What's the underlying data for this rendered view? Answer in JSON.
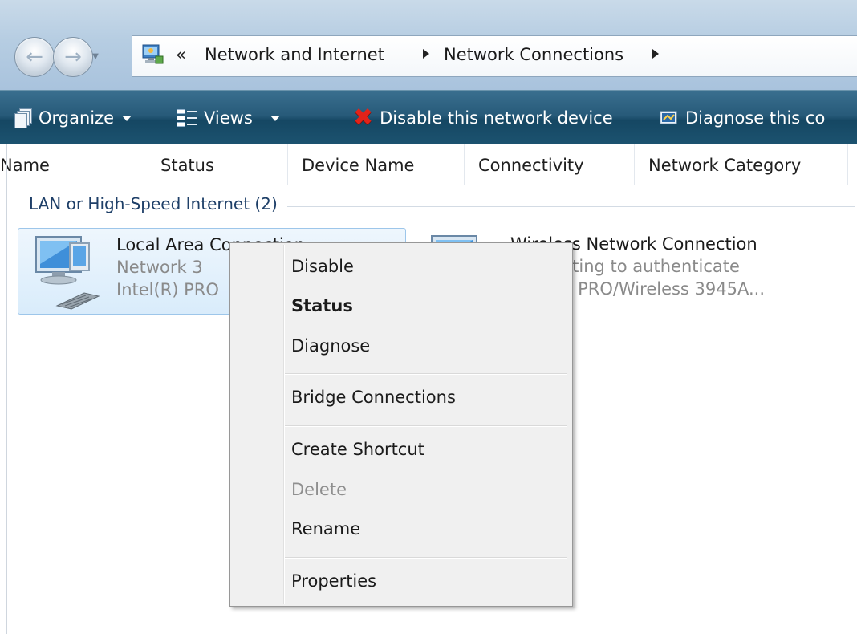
{
  "window": {
    "address_crumbs": [
      "Network and Internet",
      "Network Connections"
    ],
    "address_prefix": "«"
  },
  "commands": {
    "organize": "Organize",
    "views": "Views",
    "disable": "Disable this network device",
    "diagnose": "Diagnose this co"
  },
  "columns": [
    "Name",
    "Status",
    "Device Name",
    "Connectivity",
    "Network Category"
  ],
  "group": {
    "label": "LAN or High-Speed Internet (2)"
  },
  "items": [
    {
      "name": "Local Area Connection",
      "line2": "Network 3",
      "line3": "Intel(R) PRO",
      "selected": true
    },
    {
      "name": "Wireless Network Connection",
      "line2": "Attempting to authenticate",
      "line3": "Intel(R) PRO/Wireless 3945A...",
      "selected": false
    }
  ],
  "context_menu": {
    "items": [
      {
        "label": "Disable",
        "style": "normal"
      },
      {
        "label": "Status",
        "style": "bold"
      },
      {
        "label": "Diagnose",
        "style": "normal"
      },
      {
        "label": "Bridge Connections",
        "style": "normal"
      },
      {
        "label": "Create Shortcut",
        "style": "normal"
      },
      {
        "label": "Delete",
        "style": "disabled"
      },
      {
        "label": "Rename",
        "style": "normal"
      },
      {
        "label": "Properties",
        "style": "normal"
      }
    ]
  },
  "colors": {
    "command_bar": "#1c5370",
    "selection": "#d9ecfb",
    "disable_icon": "#e2231a"
  },
  "icons": [
    "back-icon",
    "forward-icon",
    "network-folder-icon",
    "organize-icon",
    "views-icon",
    "disable-x-icon",
    "diagnose-icon",
    "wired-network-icon",
    "wireless-network-icon"
  ]
}
